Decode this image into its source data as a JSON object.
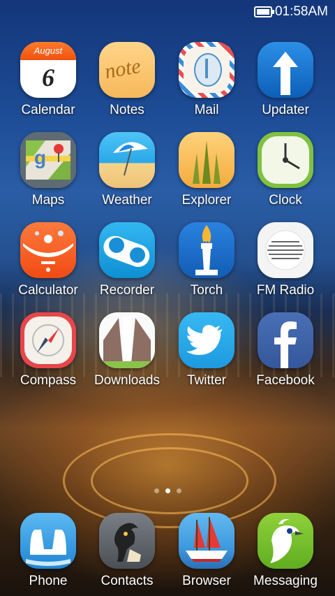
{
  "status_bar": {
    "time": "01:58AM"
  },
  "calendar_icon": {
    "month": "August",
    "day": "6"
  },
  "notes_icon": {
    "text": "note"
  },
  "apps": [
    {
      "label": "Calendar"
    },
    {
      "label": "Notes"
    },
    {
      "label": "Mail"
    },
    {
      "label": "Updater"
    },
    {
      "label": "Maps"
    },
    {
      "label": "Weather"
    },
    {
      "label": "Explorer"
    },
    {
      "label": "Clock"
    },
    {
      "label": "Calculator"
    },
    {
      "label": "Recorder"
    },
    {
      "label": "Torch"
    },
    {
      "label": "FM Radio"
    },
    {
      "label": "Compass"
    },
    {
      "label": "Downloads"
    },
    {
      "label": "Twitter"
    },
    {
      "label": "Facebook"
    }
  ],
  "dock": [
    {
      "label": "Phone"
    },
    {
      "label": "Contacts"
    },
    {
      "label": "Browser"
    },
    {
      "label": "Messaging"
    }
  ],
  "page_indicator": {
    "pages": 3,
    "current": 2
  }
}
